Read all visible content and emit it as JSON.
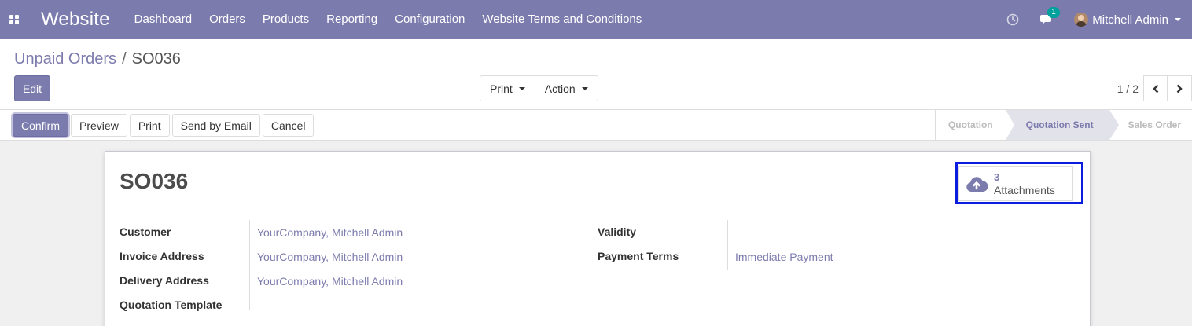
{
  "navbar": {
    "apps_icon": "apps-grid-icon",
    "brand": "Website",
    "menu": [
      "Dashboard",
      "Orders",
      "Products",
      "Reporting",
      "Configuration",
      "Website Terms and Conditions"
    ],
    "chat_badge": "1",
    "user_name": "Mitchell Admin",
    "color": "#7c7bad"
  },
  "breadcrumb": {
    "parent": "Unpaid Orders",
    "separator": "/",
    "current": "SO036"
  },
  "control": {
    "edit_label": "Edit",
    "print_label": "Print",
    "action_label": "Action",
    "pager": "1 / 2"
  },
  "statusbar": {
    "buttons": [
      "Confirm",
      "Preview",
      "Print",
      "Send by Email",
      "Cancel"
    ],
    "stages": [
      "Quotation",
      "Quotation Sent",
      "Sales Order"
    ],
    "active_stage": "Quotation Sent"
  },
  "form": {
    "title": "SO036",
    "attachments_count": "3",
    "attachments_label": "Attachments",
    "left_fields": [
      {
        "label": "Customer",
        "value": "YourCompany, Mitchell Admin"
      },
      {
        "label": "Invoice Address",
        "value": "YourCompany, Mitchell Admin"
      },
      {
        "label": "Delivery Address",
        "value": "YourCompany, Mitchell Admin"
      },
      {
        "label": "Quotation Template",
        "value": ""
      }
    ],
    "right_fields": [
      {
        "label": "Validity",
        "value": ""
      },
      {
        "label": "Payment Terms",
        "value": "Immediate Payment"
      }
    ]
  }
}
